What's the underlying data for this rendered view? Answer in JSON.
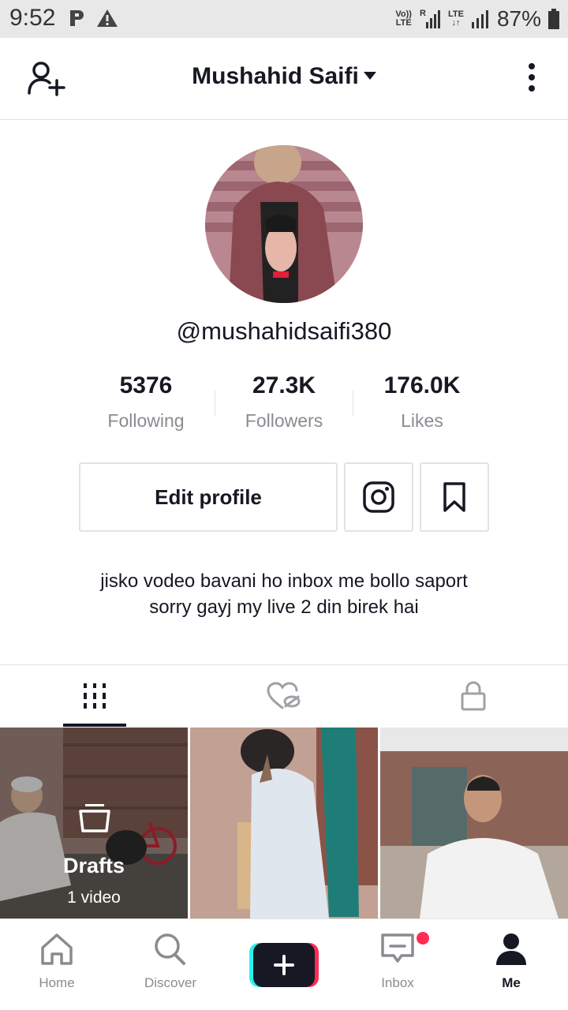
{
  "status_bar": {
    "time": "9:52",
    "carrier_volte": "Vo))",
    "carrier_lte": "LTE",
    "roaming": "R",
    "lte_label": "LTE",
    "battery_percent": "87%"
  },
  "header": {
    "title": "Mushahid Saifi"
  },
  "profile": {
    "username": "@mushahidsaifi380",
    "stats": [
      {
        "value": "5376",
        "label": "Following"
      },
      {
        "value": "27.3K",
        "label": "Followers"
      },
      {
        "value": "176.0K",
        "label": "Likes"
      }
    ],
    "edit_profile_label": "Edit profile",
    "bio_line1": "jisko vodeo bavani ho inbox me bollo saport",
    "bio_line2": "sorry gayj my live 2 din birek hai"
  },
  "tabs": [
    {
      "icon": "grid-icon",
      "active": true
    },
    {
      "icon": "liked-hidden-icon",
      "active": false
    },
    {
      "icon": "lock-icon",
      "active": false
    }
  ],
  "grid": {
    "drafts_label": "Drafts",
    "drafts_count": "1 video"
  },
  "bottom_nav": {
    "items": [
      {
        "label": "Home",
        "icon": "home-icon"
      },
      {
        "label": "Discover",
        "icon": "search-icon"
      },
      {
        "label": "",
        "icon": "plus-icon"
      },
      {
        "label": "Inbox",
        "icon": "inbox-icon"
      },
      {
        "label": "Me",
        "icon": "person-icon"
      }
    ],
    "active": "Me"
  },
  "colors": {
    "accent_red": "#fe2c55",
    "accent_cyan": "#25f4ee",
    "text_primary": "#161823",
    "text_secondary": "#8a8b91",
    "divider": "#e3e3e4"
  }
}
